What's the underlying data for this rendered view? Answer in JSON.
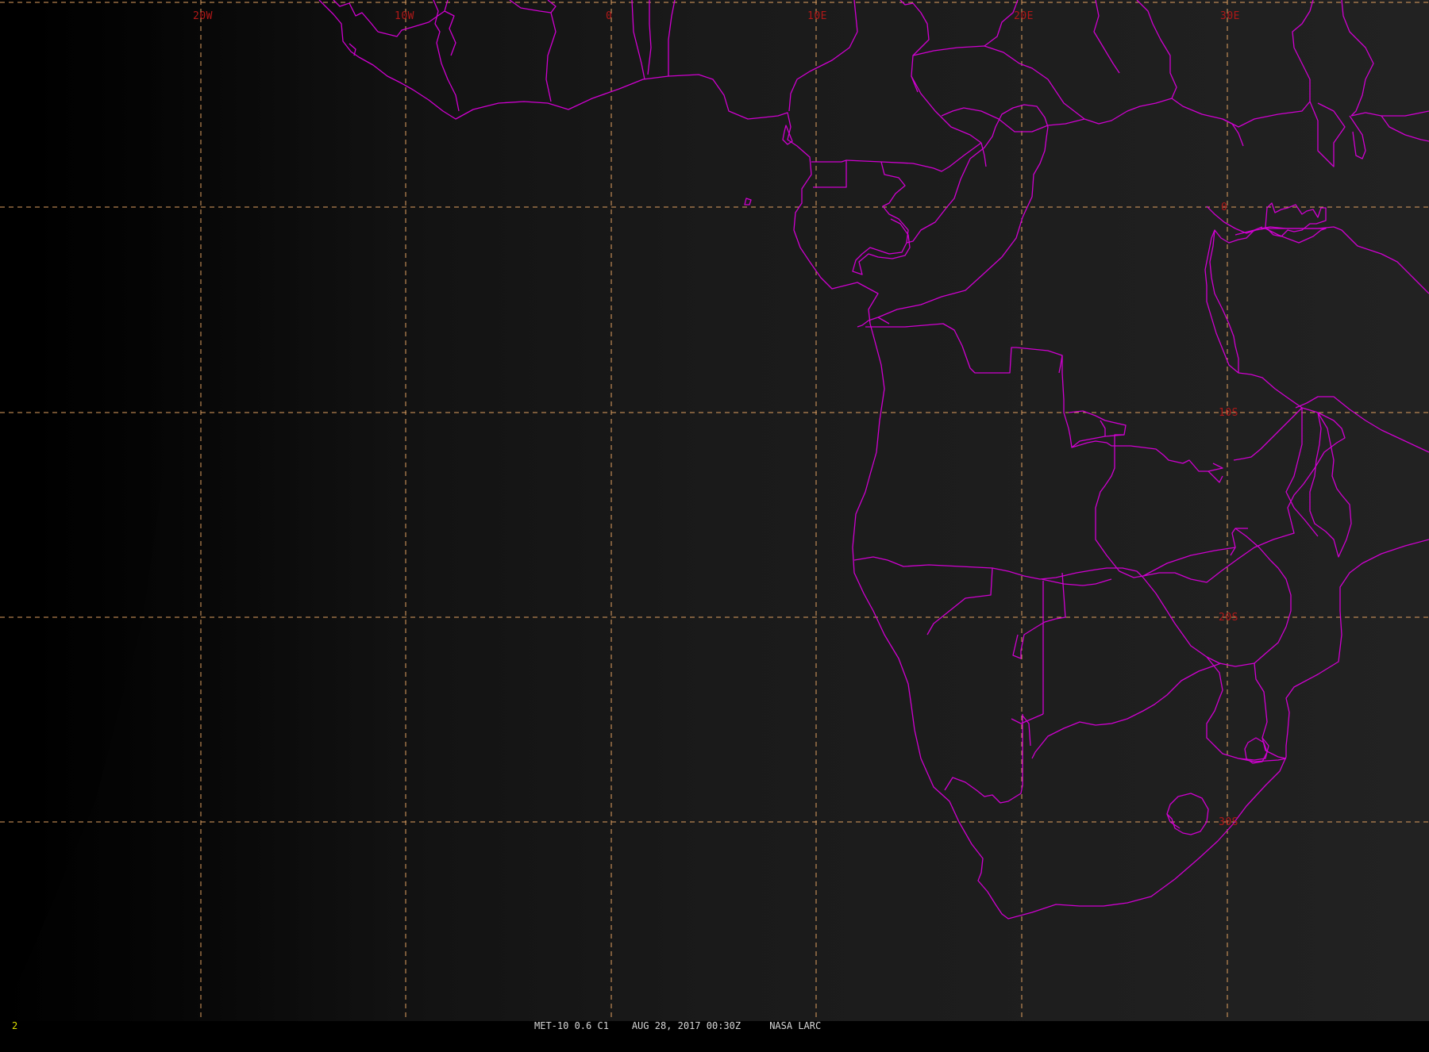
{
  "map": {
    "lon_labels": [
      "20W",
      "10W",
      "0",
      "10E",
      "20E",
      "30E"
    ],
    "lat_labels": [
      "0",
      "10S",
      "20S",
      "30S"
    ],
    "colors": {
      "coastline": "#d000d0",
      "grid": "#e0a060",
      "grid_label": "#b01818",
      "background": "#1e1e1e"
    }
  },
  "status_bar": {
    "frame_number": "2",
    "caption": "MET-10 0.6 C1    AUG 28, 2017 00:30Z     NASA LARC"
  }
}
